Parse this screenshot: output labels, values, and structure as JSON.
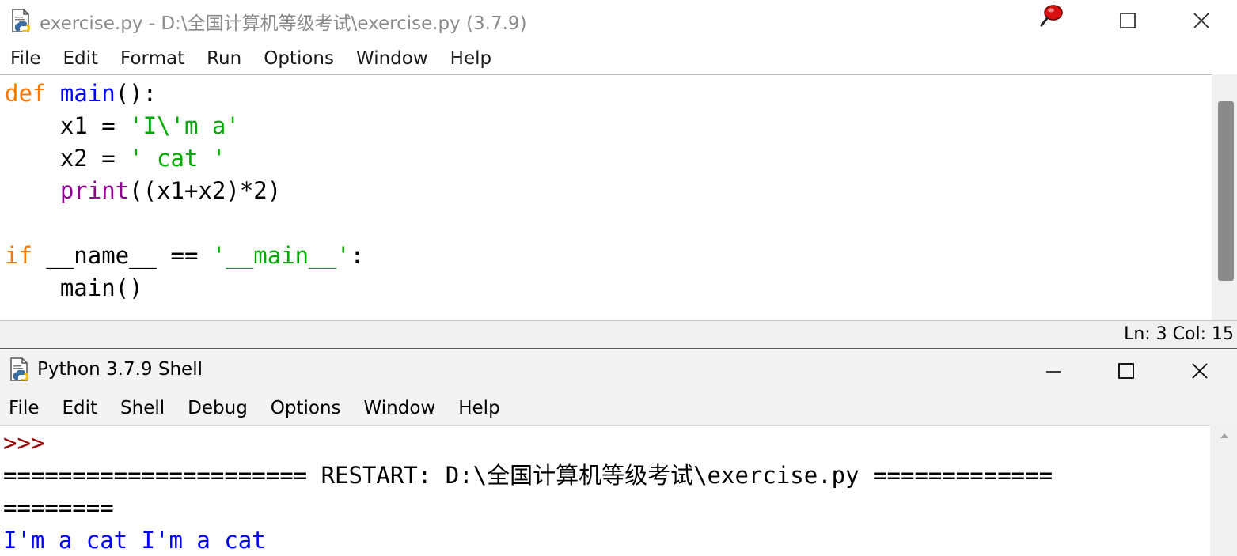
{
  "editor": {
    "title": "exercise.py - D:\\全国计算机等级考试\\exercise.py (3.7.9)",
    "menu": [
      "File",
      "Edit",
      "Format",
      "Run",
      "Options",
      "Window",
      "Help"
    ],
    "code": {
      "line1": {
        "kw": "def",
        "name": "main",
        "rest": "():"
      },
      "line2": {
        "lhs": "    x1 = ",
        "str": "'I\\'m a'"
      },
      "line3": {
        "lhs": "    x2 = ",
        "str": "' cat '"
      },
      "line4": {
        "indent": "    ",
        "bi": "print",
        "rest": "((x1+x2)*2)"
      },
      "line6": {
        "kw": "if",
        "mid": " __name__ == ",
        "str": "'__main__'",
        "end": ":"
      },
      "line7": {
        "text": "    main()"
      }
    },
    "status": "Ln: 3  Col: 15"
  },
  "shell": {
    "title": "Python 3.7.9 Shell",
    "menu": [
      "File",
      "Edit",
      "Shell",
      "Debug",
      "Options",
      "Window",
      "Help"
    ],
    "prompt": ">>>",
    "restart_line1": "====================== RESTART: D:\\全国计算机等级考试\\exercise.py =============",
    "restart_line2": "========",
    "output": "I'm a cat I'm a cat"
  },
  "icons": {
    "editor_app": "python-file-icon",
    "pin": "red-pin-icon",
    "maximize": "maximize-icon",
    "close": "close-icon",
    "minimize": "minimize-icon",
    "shell_app": "python-file-icon"
  },
  "colors": {
    "keyword": "#ff7700",
    "builtin": "#900090",
    "string": "#00aa00",
    "definition": "#0000ff",
    "prompt": "#990000",
    "output": "#0000ff"
  }
}
